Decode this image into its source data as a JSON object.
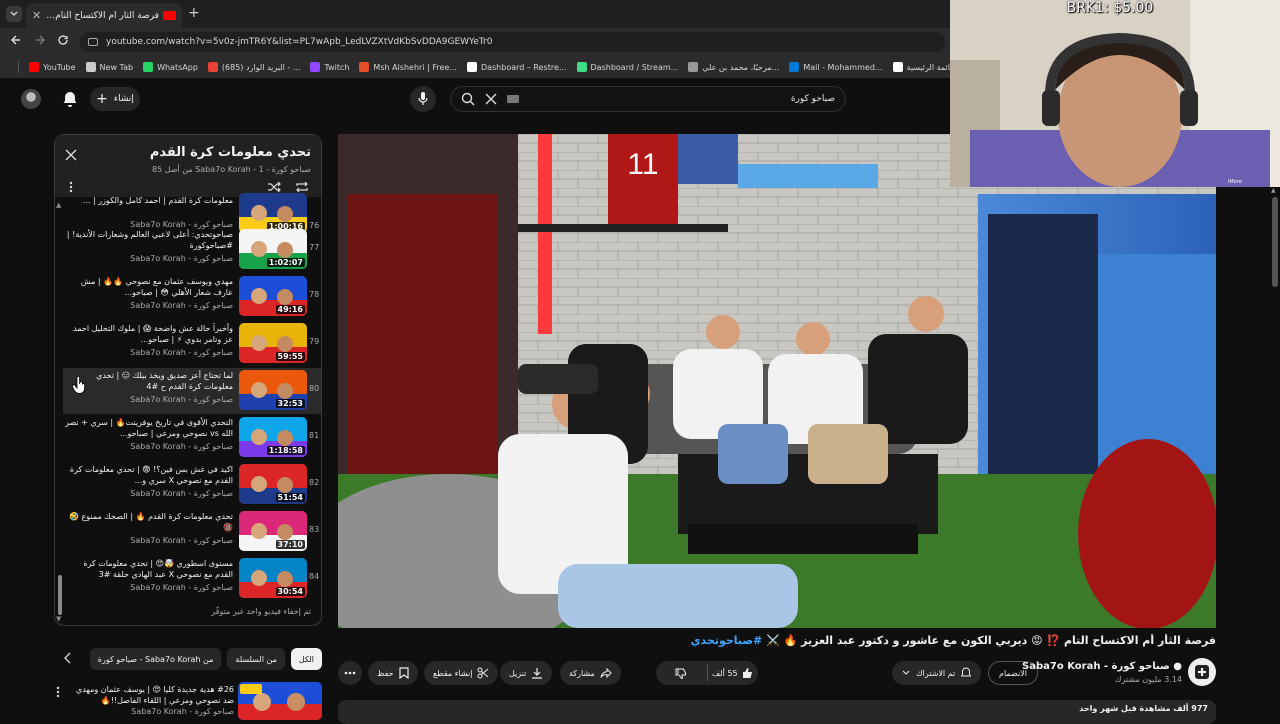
{
  "browser": {
    "tab_title": "فرصة الثأر أم الاكتساح التام !⁉",
    "tab_close": "✕",
    "new_tab": "+",
    "url": "youtube.com/watch?v=5v0z-jmTR6Y&list=PL7wApb_LedLVZXtVdKbSvDDA9GEWYeTr0",
    "bookmarks": [
      {
        "label": "YouTube",
        "color": "#ff0000"
      },
      {
        "label": "New Tab",
        "color": "#cccccc"
      },
      {
        "label": "WhatsApp",
        "color": "#25d366"
      },
      {
        "label": "(685) البريد الوارد - ...",
        "color": "#ea4335"
      },
      {
        "label": "Twitch",
        "color": "#9146ff"
      },
      {
        "label": "Msh Alshehri | Free...",
        "color": "#e44d26"
      },
      {
        "label": "Dashboard – Restre...",
        "color": "#ffffff"
      },
      {
        "label": "Dashboard / Stream...",
        "color": "#3ddc84"
      },
      {
        "label": "مرحبًا، محمد بن علي...",
        "color": "#999999"
      },
      {
        "label": "Mail - Mohammed...",
        "color": "#0078d4"
      },
      {
        "label": "القائمة الرئيسية",
        "color": "#ffffff"
      }
    ]
  },
  "header": {
    "create_label": "إنشاء",
    "search_query": "صباحو كورة"
  },
  "playlist": {
    "title": "تحدي معلومات كرة القدم",
    "subtitle": "صباحو كورة - Saba7o Korah - 1 من أصل 85",
    "items": [
      {
        "num": "76",
        "title": "معلومات كرة القدم | احمد كامل والكوزر | ...",
        "channel": "صباحو كورة - Saba7o Korah",
        "duration": "1:00:16",
        "c1": "#1e3a8a",
        "c2": "#facc15"
      },
      {
        "num": "77",
        "title": "صباحوتحدي: أعلى لاعبي العالم وشعارات الأندية! | #صباحوكورة",
        "channel": "صباحو كورة - Saba7o Korah",
        "duration": "1:02:07",
        "c1": "#f5f5f5",
        "c2": "#16a34a"
      },
      {
        "num": "78",
        "title": "مهدي ويوسف عثمان مع نصوحي 🔥🔥 | مش عارف شعار الأهلي 😳 | صباحو...",
        "channel": "صباحو كورة - Saba7o Korah",
        "duration": "49:16",
        "c1": "#1d4ed8",
        "c2": "#dc2626"
      },
      {
        "num": "79",
        "title": "وأخيراً حالة عش واضحة 😱 | ملوك التحليل احمد عز وتامر بدوي ⚡ | صباحو...",
        "channel": "صباحو كورة - Saba7o Korah",
        "duration": "59:55",
        "c1": "#eab308",
        "c2": "#dc2626"
      },
      {
        "num": "80",
        "title": "لما تحتاج أعز صديق ويخذ بيلك 😑 | تحدي معلومات كرة القدم ح #4",
        "channel": "صباحو كورة - Saba7o Korah",
        "duration": "32:53",
        "c1": "#ea580c",
        "c2": "#1e40af"
      },
      {
        "num": "81",
        "title": "التحدي الأقوى في تاريخ يوفرينت🔥 | سري + نصر الله vs نصوحي ومرعي | صباحو...",
        "channel": "صباحو كورة - Saba7o Korah",
        "duration": "1:18:58",
        "c1": "#0ea5e9",
        "c2": "#7c3aed"
      },
      {
        "num": "82",
        "title": "اكيد في غش بس فين؟! 😨 | تحدي معلومات كرة القدم مع نصوحي X سري و...",
        "channel": "صباحو كورة - Saba7o Korah",
        "duration": "51:54",
        "c1": "#dc2626",
        "c2": "#1e3a8a"
      },
      {
        "num": "83",
        "title": "تحدي معلومات كرة القدم 🔥 | الصحك ممنوع 🤣 🔞",
        "channel": "صباحو كورة - Saba7o Korah",
        "duration": "37:10",
        "c1": "#db2777",
        "c2": "#f5f5f5"
      },
      {
        "num": "84",
        "title": "مستوى اسطوري 🤯😍 | تحدي معلومات كرة القدم مع نصوحي X عبد الهادي حلقة #3",
        "channel": "صباحو كورة - Saba7o Korah",
        "duration": "30:54",
        "c1": "#0284c7",
        "c2": "#dc2626"
      }
    ],
    "hidden_note": "تم إخفاء فيديو واحد غير متوفّر"
  },
  "chips": [
    {
      "label": "الكل",
      "selected": true
    },
    {
      "label": "من السلسلة",
      "selected": false
    },
    {
      "label": "من Saba7o Korah - صباحو كورة",
      "selected": false
    }
  ],
  "recommended": {
    "title": "#26 هدية جديدة كليا 😍 | يوسف عثمان ومهدي ضد نصوحي ومرعي | اللقاء الفاصل!!🔥",
    "channel": "صباحو كورة - Saba7o Korah"
  },
  "video": {
    "title": "فرصة الثأر أم الاكتساح التام ⁉️ 😡 ديربي الكون مع عاشور و دكتور عبد العزيز 🔥 ⚔️ ",
    "hashtag": "#صباحوتحدي",
    "jersey_number": "11",
    "channel_name": "صباحو كورة - Saba7o Korah",
    "subscribers": "3.14 مليون مشترك",
    "join_label": "الانضمام",
    "subscribed_label": "تم الاشتراك",
    "likes": "55 ألف",
    "share_label": "مشاركة",
    "download_label": "تنزيل",
    "clip_label": "إنشاء مقطع",
    "save_label": "حفظ",
    "views_line": "977 ألف مشاهدة قبل شهر واحد"
  },
  "overlay": {
    "donation": "BRK1: $5.00",
    "cam_label": "iMore"
  }
}
